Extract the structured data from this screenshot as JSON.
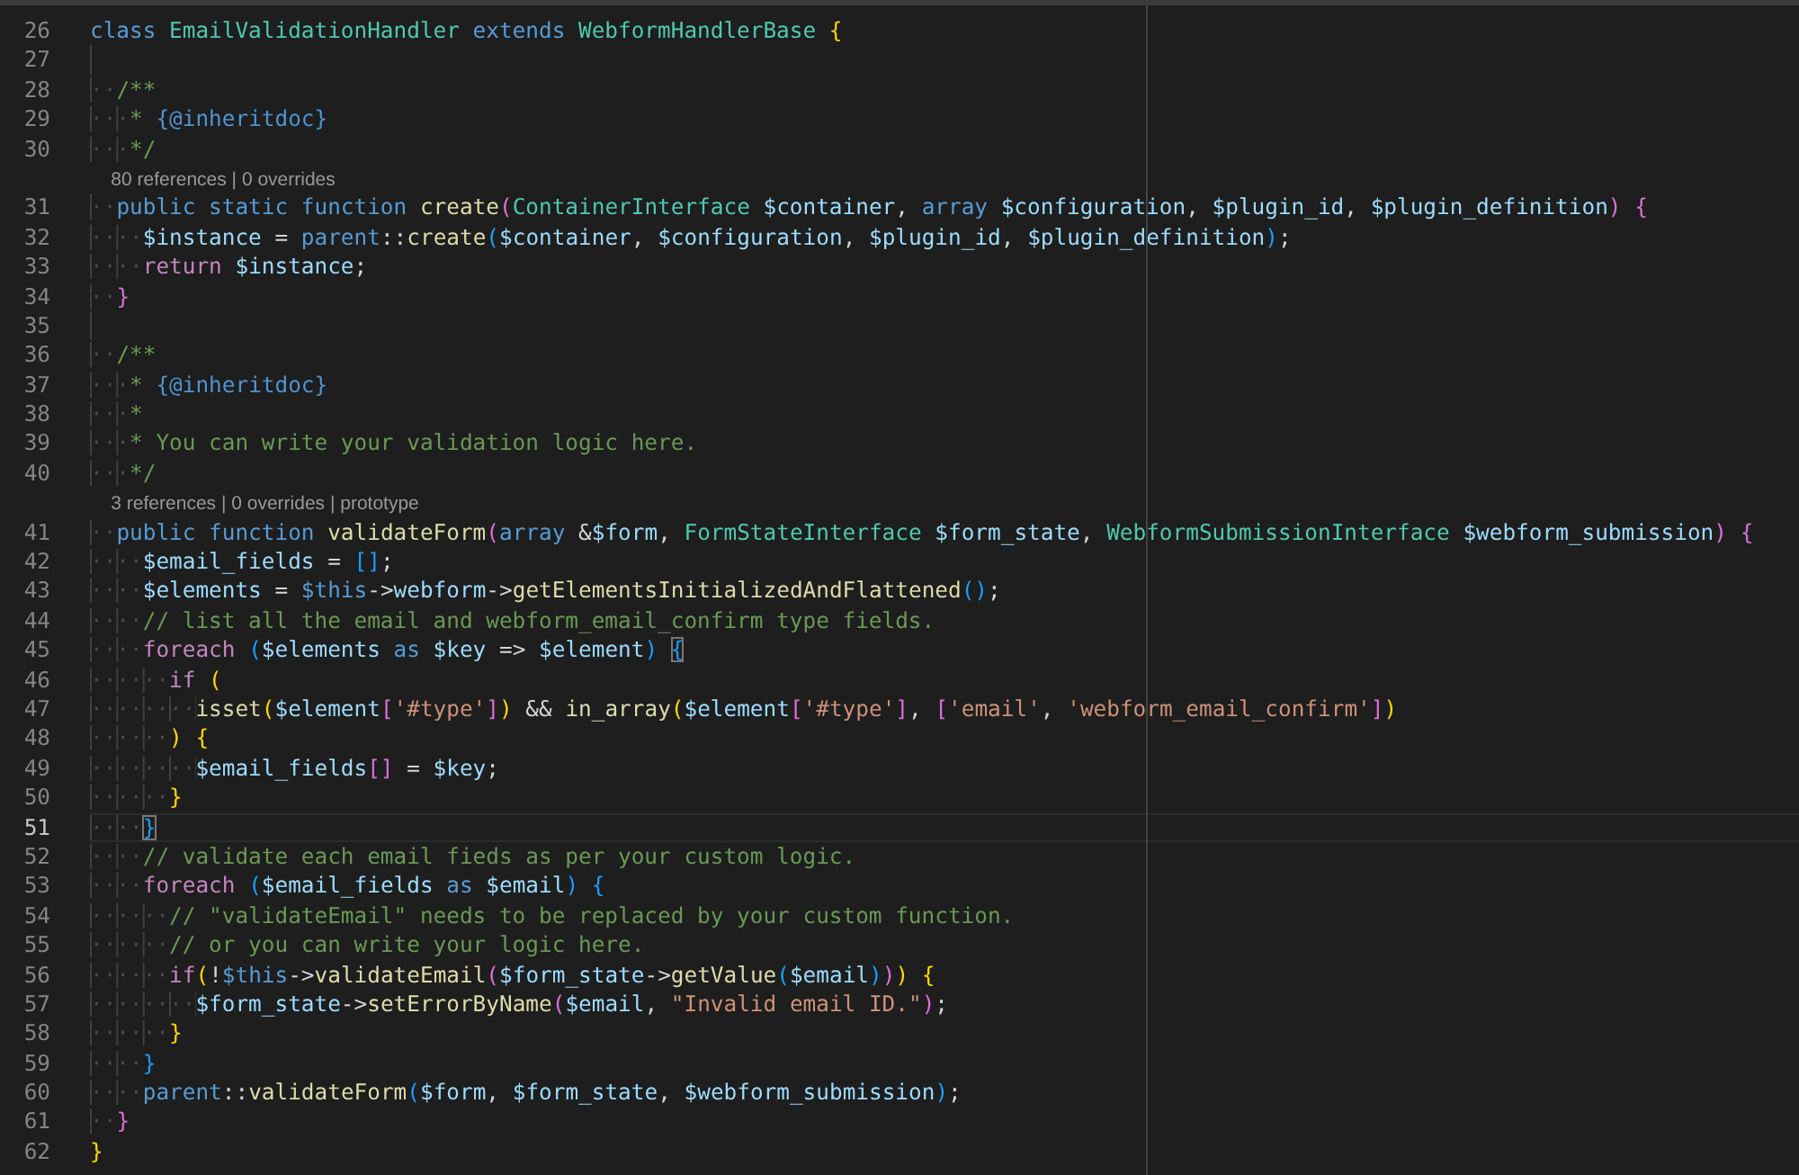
{
  "editor": {
    "lines": [
      {
        "kind": "code",
        "number": "26",
        "active": false,
        "tokens": [
          {
            "kind": "k",
            "text": "class "
          },
          {
            "kind": "t",
            "text": "EmailValidationHandler "
          },
          {
            "kind": "k",
            "text": "extends "
          },
          {
            "kind": "t",
            "text": "WebformHandlerBase "
          },
          {
            "kind": "y",
            "text": "{"
          }
        ]
      },
      {
        "kind": "code",
        "number": "27",
        "active": false
      },
      {
        "kind": "code",
        "number": "28",
        "active": false,
        "indent": "··",
        "tokens": [
          {
            "kind": "m",
            "text": "/**"
          }
        ]
      },
      {
        "kind": "code",
        "number": "29",
        "active": false,
        "indent": "···",
        "tokens": [
          {
            "kind": "m",
            "text": "* "
          },
          {
            "kind": "d",
            "text": "{@inheritdoc}"
          }
        ]
      },
      {
        "kind": "code",
        "number": "30",
        "active": false,
        "indent": "···",
        "tokens": [
          {
            "kind": "m",
            "text": "*/"
          }
        ]
      },
      {
        "kind": "codelens",
        "text": "80 references | 0 overrides"
      },
      {
        "kind": "code",
        "number": "31",
        "active": false,
        "indent": "··",
        "tokens": [
          {
            "kind": "k",
            "text": "public static function "
          },
          {
            "kind": "f",
            "text": "create"
          },
          {
            "kind": "o",
            "text": "("
          },
          {
            "kind": "t",
            "text": "ContainerInterface "
          },
          {
            "kind": "v",
            "text": "$container"
          },
          {
            "kind": "p",
            "text": ", "
          },
          {
            "kind": "k",
            "text": "array "
          },
          {
            "kind": "v",
            "text": "$configuration"
          },
          {
            "kind": "p",
            "text": ", "
          },
          {
            "kind": "v",
            "text": "$plugin_id"
          },
          {
            "kind": "p",
            "text": ", "
          },
          {
            "kind": "v",
            "text": "$plugin_definition"
          },
          {
            "kind": "o",
            "text": ") "
          },
          {
            "kind": "o",
            "text": "{"
          }
        ]
      },
      {
        "kind": "code",
        "number": "32",
        "active": false,
        "indent": "····",
        "tokens": [
          {
            "kind": "v",
            "text": "$instance"
          },
          {
            "kind": "p",
            "text": " = "
          },
          {
            "kind": "k",
            "text": "parent"
          },
          {
            "kind": "p",
            "text": "::"
          },
          {
            "kind": "f",
            "text": "create"
          },
          {
            "kind": "u",
            "text": "("
          },
          {
            "kind": "v",
            "text": "$container"
          },
          {
            "kind": "p",
            "text": ", "
          },
          {
            "kind": "v",
            "text": "$configuration"
          },
          {
            "kind": "p",
            "text": ", "
          },
          {
            "kind": "v",
            "text": "$plugin_id"
          },
          {
            "kind": "p",
            "text": ", "
          },
          {
            "kind": "v",
            "text": "$plugin_definition"
          },
          {
            "kind": "u",
            "text": ")"
          },
          {
            "kind": "p",
            "text": ";"
          }
        ]
      },
      {
        "kind": "code",
        "number": "33",
        "active": false,
        "indent": "····",
        "tokens": [
          {
            "kind": "c",
            "text": "return "
          },
          {
            "kind": "v",
            "text": "$instance"
          },
          {
            "kind": "p",
            "text": ";"
          }
        ]
      },
      {
        "kind": "code",
        "number": "34",
        "active": false,
        "indent": "··",
        "tokens": [
          {
            "kind": "o",
            "text": "}"
          }
        ]
      },
      {
        "kind": "code",
        "number": "35",
        "active": false
      },
      {
        "kind": "code",
        "number": "36",
        "active": false,
        "indent": "··",
        "tokens": [
          {
            "kind": "m",
            "text": "/**"
          }
        ]
      },
      {
        "kind": "code",
        "number": "37",
        "active": false,
        "indent": "···",
        "tokens": [
          {
            "kind": "m",
            "text": "* "
          },
          {
            "kind": "d",
            "text": "{@inheritdoc}"
          }
        ]
      },
      {
        "kind": "code",
        "number": "38",
        "active": false,
        "indent": "···",
        "tokens": [
          {
            "kind": "m",
            "text": "*"
          }
        ]
      },
      {
        "kind": "code",
        "number": "39",
        "active": false,
        "indent": "···",
        "tokens": [
          {
            "kind": "m",
            "text": "* You can write your validation logic here."
          }
        ]
      },
      {
        "kind": "code",
        "number": "40",
        "active": false,
        "indent": "···",
        "tokens": [
          {
            "kind": "m",
            "text": "*/"
          }
        ]
      },
      {
        "kind": "codelens",
        "text": "3 references | 0 overrides | prototype"
      },
      {
        "kind": "code",
        "number": "41",
        "active": false,
        "indent": "··",
        "tokens": [
          {
            "kind": "k",
            "text": "public function "
          },
          {
            "kind": "f",
            "text": "validateForm"
          },
          {
            "kind": "o",
            "text": "("
          },
          {
            "kind": "k",
            "text": "array "
          },
          {
            "kind": "p",
            "text": "&"
          },
          {
            "kind": "v",
            "text": "$form"
          },
          {
            "kind": "p",
            "text": ", "
          },
          {
            "kind": "t",
            "text": "FormStateInterface "
          },
          {
            "kind": "v",
            "text": "$form_state"
          },
          {
            "kind": "p",
            "text": ", "
          },
          {
            "kind": "t",
            "text": "WebformSubmissionInterface "
          },
          {
            "kind": "v",
            "text": "$webform_submission"
          },
          {
            "kind": "o",
            "text": ") "
          },
          {
            "kind": "o",
            "text": "{"
          }
        ]
      },
      {
        "kind": "code",
        "number": "42",
        "active": false,
        "indent": "····",
        "tokens": [
          {
            "kind": "v",
            "text": "$email_fields"
          },
          {
            "kind": "p",
            "text": " = "
          },
          {
            "kind": "u",
            "text": "[]"
          },
          {
            "kind": "p",
            "text": ";"
          }
        ]
      },
      {
        "kind": "code",
        "number": "43",
        "active": false,
        "indent": "····",
        "tokens": [
          {
            "kind": "v",
            "text": "$elements"
          },
          {
            "kind": "p",
            "text": " = "
          },
          {
            "kind": "k",
            "text": "$this"
          },
          {
            "kind": "p",
            "text": "->"
          },
          {
            "kind": "v",
            "text": "webform"
          },
          {
            "kind": "p",
            "text": "->"
          },
          {
            "kind": "f",
            "text": "getElementsInitializedAndFlattened"
          },
          {
            "kind": "u",
            "text": "()"
          },
          {
            "kind": "p",
            "text": ";"
          }
        ]
      },
      {
        "kind": "code",
        "number": "44",
        "active": false,
        "indent": "····",
        "tokens": [
          {
            "kind": "m",
            "text": "// list all the email and webform_email_confirm type fields."
          }
        ]
      },
      {
        "kind": "code",
        "number": "45",
        "active": false,
        "indent": "····",
        "tokens": [
          {
            "kind": "c",
            "text": "foreach "
          },
          {
            "kind": "u",
            "text": "("
          },
          {
            "kind": "v",
            "text": "$elements "
          },
          {
            "kind": "k",
            "text": "as "
          },
          {
            "kind": "v",
            "text": "$key"
          },
          {
            "kind": "p",
            "text": " => "
          },
          {
            "kind": "v",
            "text": "$element"
          },
          {
            "kind": "u",
            "text": ") "
          },
          {
            "kind": "U",
            "text": "{"
          }
        ]
      },
      {
        "kind": "code",
        "number": "46",
        "active": false,
        "indent": "······",
        "tokens": [
          {
            "kind": "c",
            "text": "if "
          },
          {
            "kind": "y",
            "text": "("
          }
        ]
      },
      {
        "kind": "code",
        "number": "47",
        "active": false,
        "indent": "········",
        "tokens": [
          {
            "kind": "f",
            "text": "isset"
          },
          {
            "kind": "y",
            "text": "("
          },
          {
            "kind": "v",
            "text": "$element"
          },
          {
            "kind": "o",
            "text": "["
          },
          {
            "kind": "s",
            "text": "'#type'"
          },
          {
            "kind": "o",
            "text": "]"
          },
          {
            "kind": "y",
            "text": ")"
          },
          {
            "kind": "p",
            "text": " && "
          },
          {
            "kind": "f",
            "text": "in_array"
          },
          {
            "kind": "y",
            "text": "("
          },
          {
            "kind": "v",
            "text": "$element"
          },
          {
            "kind": "o",
            "text": "["
          },
          {
            "kind": "s",
            "text": "'#type'"
          },
          {
            "kind": "o",
            "text": "]"
          },
          {
            "kind": "p",
            "text": ", "
          },
          {
            "kind": "o",
            "text": "["
          },
          {
            "kind": "s",
            "text": "'email'"
          },
          {
            "kind": "p",
            "text": ", "
          },
          {
            "kind": "s",
            "text": "'webform_email_confirm'"
          },
          {
            "kind": "o",
            "text": "]"
          },
          {
            "kind": "y",
            "text": ")"
          }
        ]
      },
      {
        "kind": "code",
        "number": "48",
        "active": false,
        "indent": "······",
        "tokens": [
          {
            "kind": "y",
            "text": ") "
          },
          {
            "kind": "y",
            "text": "{"
          }
        ]
      },
      {
        "kind": "code",
        "number": "49",
        "active": false,
        "indent": "········",
        "tokens": [
          {
            "kind": "v",
            "text": "$email_fields"
          },
          {
            "kind": "o",
            "text": "[]"
          },
          {
            "kind": "p",
            "text": " = "
          },
          {
            "kind": "v",
            "text": "$key"
          },
          {
            "kind": "p",
            "text": ";"
          }
        ]
      },
      {
        "kind": "code",
        "number": "50",
        "active": false,
        "indent": "······",
        "tokens": [
          {
            "kind": "y",
            "text": "}"
          }
        ]
      },
      {
        "kind": "code",
        "number": "51",
        "active": true,
        "indent": "····",
        "tokens": [
          {
            "kind": "U",
            "text": "}"
          }
        ]
      },
      {
        "kind": "code",
        "number": "52",
        "active": false,
        "indent": "····",
        "tokens": [
          {
            "kind": "m",
            "text": "// validate each email fieds as per your custom logic."
          }
        ]
      },
      {
        "kind": "code",
        "number": "53",
        "active": false,
        "indent": "····",
        "tokens": [
          {
            "kind": "c",
            "text": "foreach "
          },
          {
            "kind": "u",
            "text": "("
          },
          {
            "kind": "v",
            "text": "$email_fields "
          },
          {
            "kind": "k",
            "text": "as "
          },
          {
            "kind": "v",
            "text": "$email"
          },
          {
            "kind": "u",
            "text": ") "
          },
          {
            "kind": "u",
            "text": "{"
          }
        ]
      },
      {
        "kind": "code",
        "number": "54",
        "active": false,
        "indent": "······",
        "tokens": [
          {
            "kind": "m",
            "text": "// \"validateEmail\" needs to be replaced by your custom function."
          }
        ]
      },
      {
        "kind": "code",
        "number": "55",
        "active": false,
        "indent": "······",
        "tokens": [
          {
            "kind": "m",
            "text": "// or you can write your logic here."
          }
        ]
      },
      {
        "kind": "code",
        "number": "56",
        "active": false,
        "indent": "······",
        "tokens": [
          {
            "kind": "c",
            "text": "if"
          },
          {
            "kind": "y",
            "text": "("
          },
          {
            "kind": "p",
            "text": "!"
          },
          {
            "kind": "k",
            "text": "$this"
          },
          {
            "kind": "p",
            "text": "->"
          },
          {
            "kind": "f",
            "text": "validateEmail"
          },
          {
            "kind": "o",
            "text": "("
          },
          {
            "kind": "v",
            "text": "$form_state"
          },
          {
            "kind": "p",
            "text": "->"
          },
          {
            "kind": "f",
            "text": "getValue"
          },
          {
            "kind": "u",
            "text": "("
          },
          {
            "kind": "v",
            "text": "$email"
          },
          {
            "kind": "u",
            "text": ")"
          },
          {
            "kind": "o",
            "text": ")"
          },
          {
            "kind": "y",
            "text": ") "
          },
          {
            "kind": "y",
            "text": "{"
          }
        ]
      },
      {
        "kind": "code",
        "number": "57",
        "active": false,
        "indent": "········",
        "tokens": [
          {
            "kind": "v",
            "text": "$form_state"
          },
          {
            "kind": "p",
            "text": "->"
          },
          {
            "kind": "f",
            "text": "setErrorByName"
          },
          {
            "kind": "o",
            "text": "("
          },
          {
            "kind": "v",
            "text": "$email"
          },
          {
            "kind": "p",
            "text": ", "
          },
          {
            "kind": "s",
            "text": "\"Invalid email ID.\""
          },
          {
            "kind": "o",
            "text": ")"
          },
          {
            "kind": "p",
            "text": ";"
          }
        ]
      },
      {
        "kind": "code",
        "number": "58",
        "active": false,
        "indent": "······",
        "tokens": [
          {
            "kind": "y",
            "text": "}"
          }
        ]
      },
      {
        "kind": "code",
        "number": "59",
        "active": false,
        "indent": "····",
        "tokens": [
          {
            "kind": "u",
            "text": "}"
          }
        ]
      },
      {
        "kind": "code",
        "number": "60",
        "active": false,
        "indent": "····",
        "tokens": [
          {
            "kind": "k",
            "text": "parent"
          },
          {
            "kind": "p",
            "text": "::"
          },
          {
            "kind": "f",
            "text": "validateForm"
          },
          {
            "kind": "u",
            "text": "("
          },
          {
            "kind": "v",
            "text": "$form"
          },
          {
            "kind": "p",
            "text": ", "
          },
          {
            "kind": "v",
            "text": "$form_state"
          },
          {
            "kind": "p",
            "text": ", "
          },
          {
            "kind": "v",
            "text": "$webform_submission"
          },
          {
            "kind": "u",
            "text": ")"
          },
          {
            "kind": "p",
            "text": ";"
          }
        ]
      },
      {
        "kind": "code",
        "number": "61",
        "active": false,
        "indent": "··",
        "tokens": [
          {
            "kind": "o",
            "text": "}"
          }
        ]
      },
      {
        "kind": "code",
        "number": "62",
        "active": false,
        "tokens": [
          {
            "kind": "y",
            "text": "}"
          }
        ]
      }
    ]
  }
}
